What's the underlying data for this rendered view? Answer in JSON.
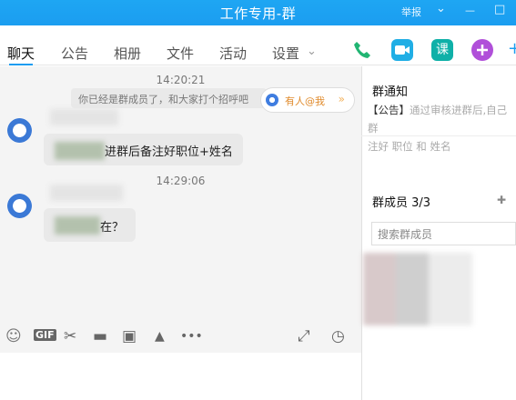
{
  "window": {
    "title": "工作专用-群",
    "report": "举报",
    "dropdown_glyph": "⌄",
    "minimize_glyph": "—",
    "maximize_glyph": "□"
  },
  "tabs": [
    {
      "label": "聊天"
    },
    {
      "label": "公告"
    },
    {
      "label": "相册"
    },
    {
      "label": "文件"
    },
    {
      "label": "活动"
    },
    {
      "label": "设置"
    }
  ],
  "tab_dropdown_glyph": "⌄",
  "toolbar": {
    "phone_icon": "phone-icon",
    "video_icon": "video-icon",
    "course_label": "课",
    "add_icon": "plus-icon"
  },
  "chat": {
    "time1": "14:20:21",
    "system_message": "你已经是群成员了，和大家打个招呼吧",
    "mention_pill": "有人@我",
    "mention_arrow": "»",
    "message1_text": "进群后备注好职位+姓名",
    "time2": "14:29:06",
    "message2_text": "在？"
  },
  "input_toolbar": {
    "emoji": "☺",
    "gif": "GIF",
    "scissors": "✂",
    "folder": "▬",
    "image": "▣",
    "bell": "▲",
    "more": "•••",
    "expand": "⤢",
    "history": "◷"
  },
  "sidebar": {
    "notice_title": "群通知",
    "notice_text": "【公告】通过审核进群后,自己群名片 职位 和 姓名",
    "notice_tag": "【公告】",
    "notice_body": "通过审核进群后,自己群",
    "notice_body2": "注好 职位 和 姓名",
    "members_title": "群成员 3/3",
    "search_placeholder": "搜索群成员",
    "add_member_glyph": "✚"
  },
  "colors": {
    "accent": "#1b9df0",
    "title_bar": "#1ea6f3",
    "phone_green": "#21b573",
    "video_blue": "#20aee5",
    "course_teal": "#0fb0a8",
    "plus_purple": "#b04fd9"
  }
}
